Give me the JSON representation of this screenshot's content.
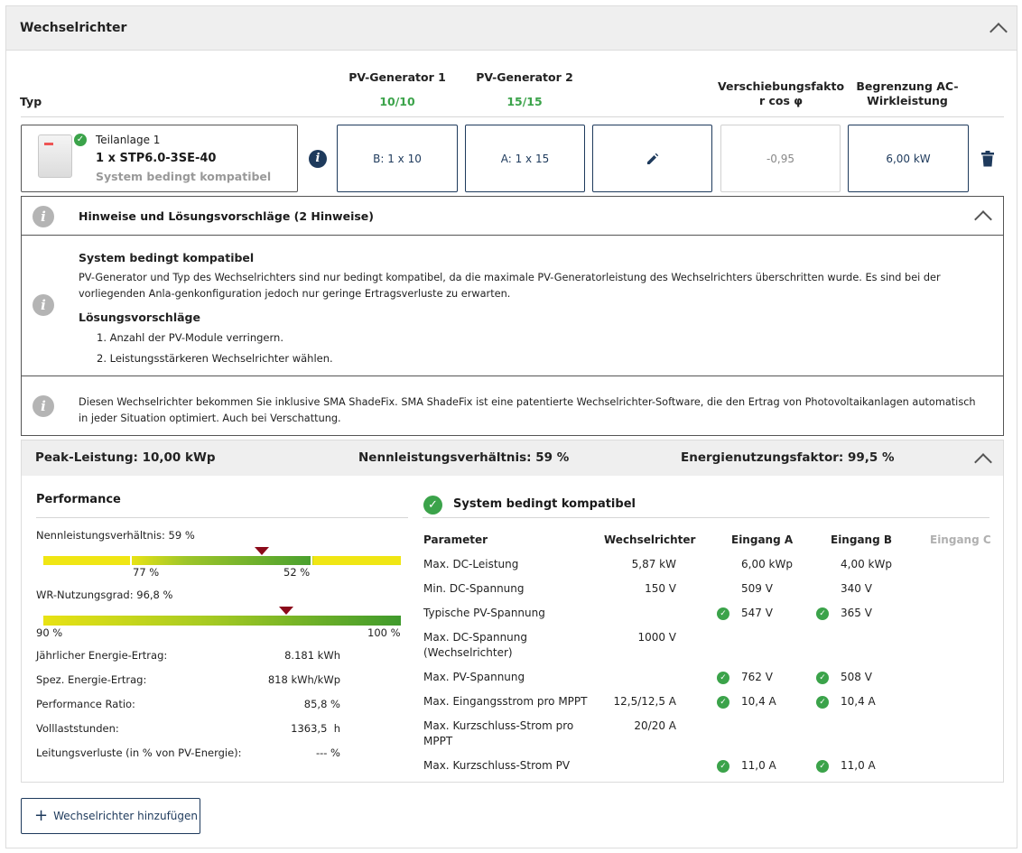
{
  "panel": {
    "title": "Wechselrichter"
  },
  "columns": {
    "typ": "Typ",
    "pv1_title": "PV-Generator 1",
    "pv1_count": "10/10",
    "pv2_title": "PV-Generator 2",
    "pv2_count": "15/15",
    "cos_line1": "Verschiebungsfakto",
    "cos_line2": "r cos φ",
    "ac_line1": "Begrenzung AC-",
    "ac_line2": "Wirkleistung"
  },
  "inverter": {
    "subsystem": "Teilanlage 1",
    "model": "1 x STP6.0-3SE-40",
    "status": "System bedingt kompatibel",
    "pv1_value": "B: 1 x 10",
    "pv2_value": "A: 1 x 15",
    "cos_value": "-0,95",
    "ac_value": "6,00 kW"
  },
  "hints": {
    "header": "Hinweise und Lösungsvorschläge (2 Hinweise)",
    "hint1_title": "System bedingt kompatibel",
    "hint1_text_line1": "PV-Generator und Typ des Wechselrichters sind nur bedingt kompatibel, da die maximale PV-Generatorleistung des Wechselrichters überschritten wurde. Es sind bei der",
    "hint1_text_line2": "vorliegenden Anla-genkonfiguration jedoch nur geringe Ertragsverluste zu erwarten.",
    "solutions_title": "Lösungsvorschläge",
    "solution1": "1. Anzahl der PV-Module verringern.",
    "solution2": "2. Leistungsstärkeren Wechselrichter wählen.",
    "hint2_line1": "Diesen Wechselrichter bekommen Sie inklusive SMA ShadeFix. SMA ShadeFix ist eine patentierte Wechselrichter-Software, die den Ertrag von Photovoltaikanlagen automatisch",
    "hint2_line2": "in jeder Situation optimiert. Auch bei Verschattung."
  },
  "summary": {
    "peak": "Peak-Leistung: 10,00 kWp",
    "ratio": "Nennleistungsverhältnis: 59 %",
    "energy_factor": "Energienutzungsfaktor: 99,5 %"
  },
  "performance": {
    "title": "Performance",
    "nenn_label": "Nennleistungsverhältnis: 59 %",
    "nenn_tick1": "77 %",
    "nenn_tick2": "52 %",
    "wr_label": "WR-Nutzungsgrad: 96,8 %",
    "wr_min": "90 %",
    "wr_max": "100 %",
    "wr_fraction": 0.68,
    "stats": [
      {
        "label": "Jährlicher Energie-Ertrag:",
        "value": "8.181 kWh"
      },
      {
        "label": "Spez. Energie-Ertrag:",
        "value": "818 kWh/kWp"
      },
      {
        "label": "Performance Ratio:",
        "value": "85,8 %"
      },
      {
        "label": "Volllaststunden:",
        "value": "1363,5  h"
      },
      {
        "label": "Leitungsverluste (in % von PV-Energie):",
        "value": "--- %"
      }
    ]
  },
  "compat": {
    "title": "System bedingt kompatibel",
    "headers": {
      "param": "Parameter",
      "wr": "Wechselrichter",
      "a": "Eingang A",
      "b": "Eingang B",
      "c": "Eingang C"
    },
    "rows": [
      {
        "param": "Max. DC-Leistung",
        "param2": "",
        "wr": "5,87 kW",
        "a": "6,00 kWp",
        "b": "4,00 kWp",
        "check": false
      },
      {
        "param": "Min. DC-Spannung",
        "param2": "",
        "wr": "150 V",
        "a": "509 V",
        "b": "340 V",
        "check": false
      },
      {
        "param": "Typische PV-Spannung",
        "param2": "",
        "wr": "",
        "a": "547 V",
        "b": "365 V",
        "check": true
      },
      {
        "param": "Max. DC-Spannung",
        "param2": "(Wechselrichter)",
        "wr": "1000 V",
        "a": "",
        "b": "",
        "check": false
      },
      {
        "param": "Max. PV-Spannung",
        "param2": "",
        "wr": "",
        "a": "762 V",
        "b": "508 V",
        "check": true
      },
      {
        "param": "Max. Eingangsstrom pro MPPT",
        "param2": "",
        "wr": "12,5/12,5 A",
        "a": "10,4 A",
        "b": "10,4 A",
        "check": true
      },
      {
        "param": "Max. Kurzschluss-Strom pro",
        "param2": "MPPT",
        "wr": "20/20 A",
        "a": "",
        "b": "",
        "check": false
      },
      {
        "param": "Max. Kurzschluss-Strom PV",
        "param2": "",
        "wr": "",
        "a": "11,0 A",
        "b": "11,0 A",
        "check": true
      }
    ]
  },
  "add_button": "Wechselrichter hinzufügen",
  "colors": {
    "accent": "#1e3a5c",
    "ok": "#3ba34a",
    "marker": "#8b0a1a"
  }
}
